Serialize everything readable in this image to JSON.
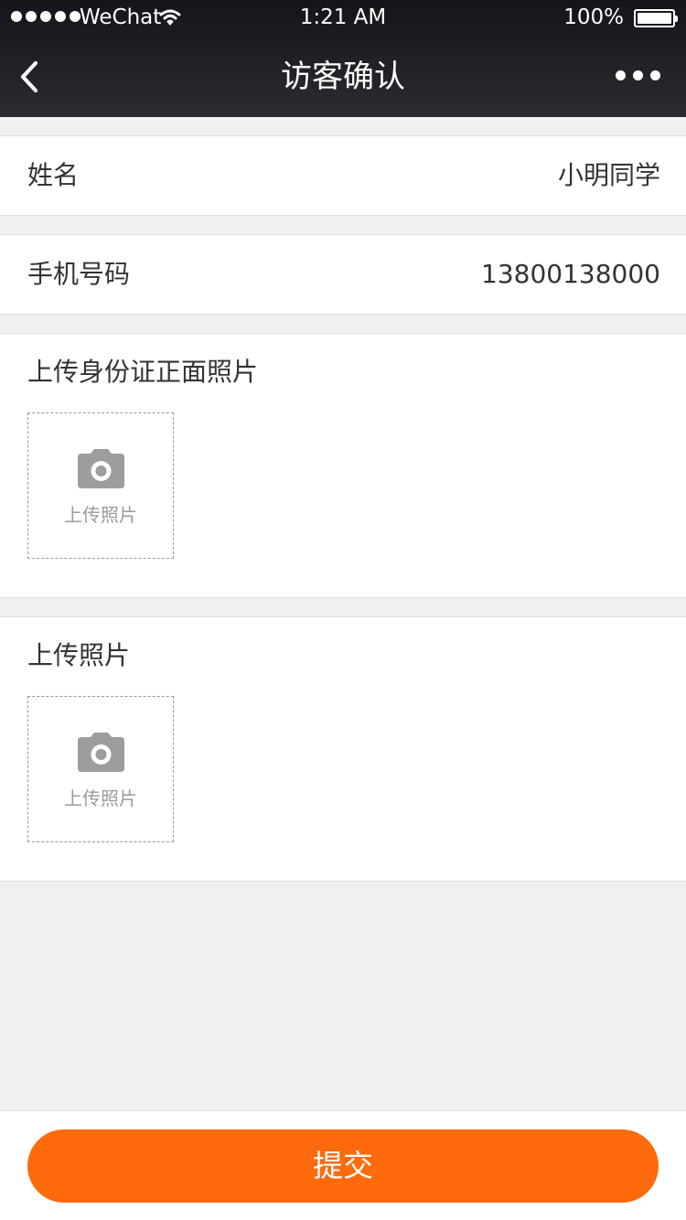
{
  "status_bar": {
    "carrier": "WeChat",
    "time": "1:21 AM",
    "battery": "100%"
  },
  "nav": {
    "title": "访客确认"
  },
  "form": {
    "name_label": "姓名",
    "name_value": "小明同学",
    "phone_label": "手机号码",
    "phone_value": "13800138000"
  },
  "uploads": [
    {
      "title": "上传身份证正面照片",
      "button_label": "上传照片",
      "icon": "camera-icon"
    },
    {
      "title": "上传照片",
      "button_label": "上传照片",
      "icon": "camera-icon"
    }
  ],
  "footer": {
    "submit_label": "提交"
  },
  "colors": {
    "accent": "#ff6a0c",
    "topbar_background": "#14151a",
    "page_background": "#f0f0f0"
  }
}
